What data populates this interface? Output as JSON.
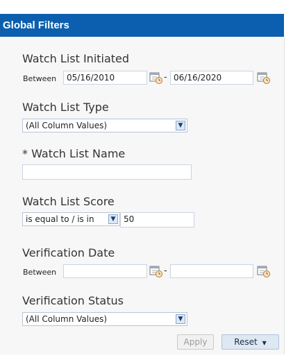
{
  "header": {
    "title": "Global Filters"
  },
  "filters": {
    "watch_list_initiated": {
      "label": "Watch List Initiated",
      "operator": "Between",
      "from": "05/16/2010",
      "separator": "-",
      "to": "06/16/2020"
    },
    "watch_list_type": {
      "label": "Watch List Type",
      "value": "(All Column Values)"
    },
    "watch_list_name": {
      "label": "* Watch List Name",
      "value": ""
    },
    "watch_list_score": {
      "label": "Watch List Score",
      "operator": "is equal to / is in",
      "value": "50"
    },
    "verification_date": {
      "label": "Verification Date",
      "operator": "Between",
      "from": "",
      "separator": "-",
      "to": ""
    },
    "verification_status": {
      "label": "Verification Status",
      "value": "(All Column Values)"
    }
  },
  "buttons": {
    "apply": "Apply",
    "reset": "Reset"
  },
  "icons": {
    "calendar": "calendar-icon",
    "dropdown": "chevron-down-icon",
    "reset_caret": "caret-down-icon"
  },
  "colors": {
    "header_bg": "#0b5fae",
    "panel_bg": "#f7f7f7",
    "input_border": "#c8d4e2",
    "reset_bg": "#dde8f3"
  }
}
